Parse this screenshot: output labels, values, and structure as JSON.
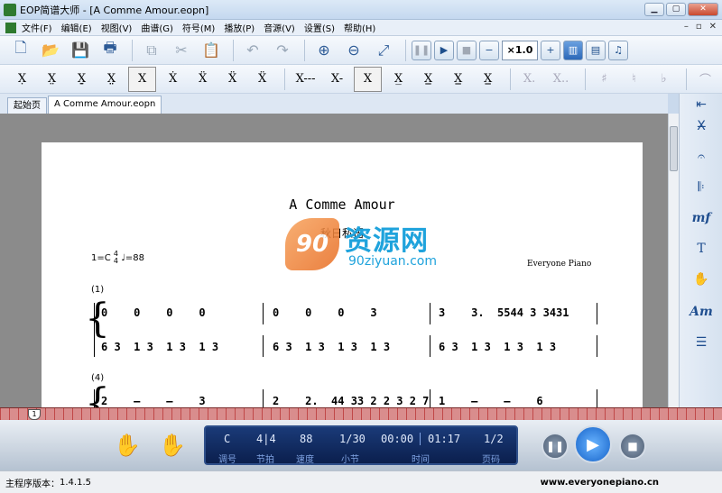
{
  "window": {
    "title": "EOP简谱大师 - [A Comme Amour.eopn]"
  },
  "menu": {
    "items": [
      "文件(F)",
      "编辑(E)",
      "视图(V)",
      "曲谱(G)",
      "符号(M)",
      "播放(P)",
      "音源(V)",
      "设置(S)",
      "帮助(H)"
    ]
  },
  "toolbar": {
    "speed": "×1.0"
  },
  "tabs": [
    {
      "label": "起始页"
    },
    {
      "label": "A Comme Amour.eopn"
    }
  ],
  "score": {
    "title": "A Comme Amour",
    "subtitle": "秋日私语",
    "key": "1=C",
    "time_num": "4",
    "time_den": "4",
    "tempo": "=88",
    "composer": "Everyone Piano",
    "measures": [
      {
        "number": "(1)",
        "upper": [
          "0    0    0    0",
          "0    0    0    3",
          "3    3.  5544 3 3431"
        ],
        "lower": [
          "6 3  1 3  1 3  1 3",
          "6 3  1 3  1 3  1 3",
          "6 3  1 3  1 3  1 3"
        ]
      },
      {
        "number": "(4)",
        "upper": [
          "2    –    –    3",
          "2    2.  44 33 2 2 3 2 7",
          "1    –    –    6"
        ]
      }
    ]
  },
  "watermark": {
    "logo": "90",
    "cn": "资源网",
    "url": "90ziyuan.com"
  },
  "ruler": {
    "position": "1"
  },
  "player": {
    "key": "C",
    "key_label": "调号",
    "meter": "4|4",
    "meter_label": "节拍",
    "tempo": "88",
    "tempo_label": "速度",
    "measure": "1/30",
    "measure_label": "小节",
    "time_elapsed": "00:00",
    "time_total": "01:17",
    "time_label": "时间",
    "page": "1/2",
    "page_label": "页码"
  },
  "status": {
    "version_label": "主程序版本：",
    "version": "1.4.1.5",
    "url": "www.everyonepiano.cn"
  },
  "colors": {
    "accent": "#1663c9",
    "lcd": "#0b1f4d",
    "ruler": "#c04848"
  }
}
